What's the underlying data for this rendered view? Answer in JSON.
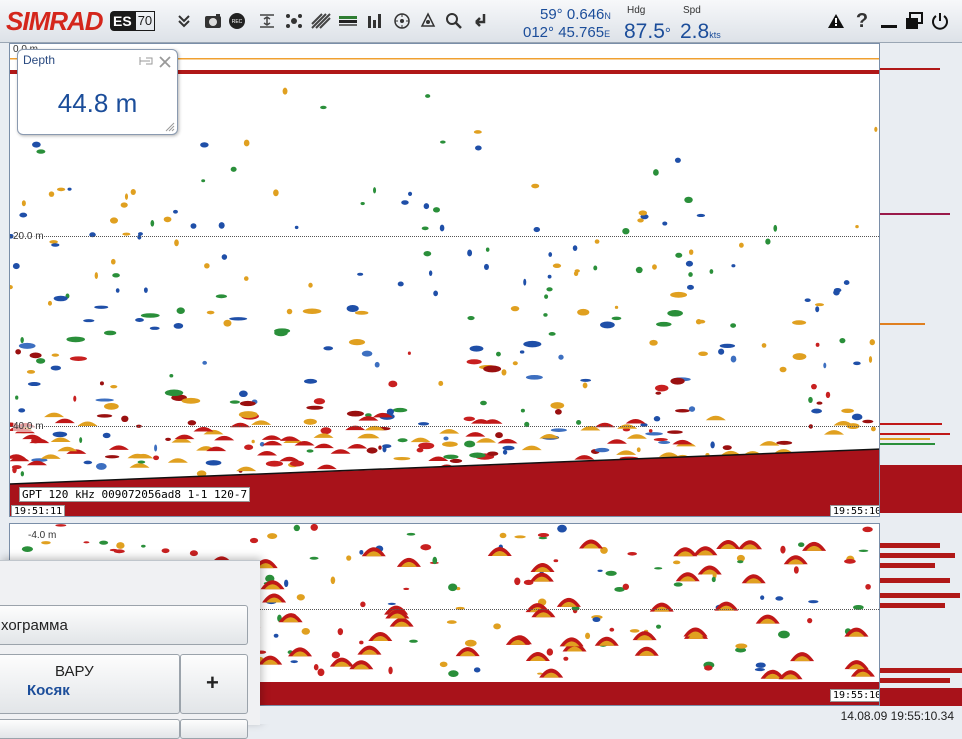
{
  "toolbar": {
    "logo": "SIMRAD",
    "model_es": "ES",
    "model_num": "70",
    "icons": [
      "expand-icon",
      "camera-icon",
      "record-icon",
      "range-icon",
      "pings-icon",
      "echogram-icon",
      "colorbar-icon",
      "bars-icon",
      "target-icon",
      "ship-icon",
      "search-icon",
      "cursor-icon",
      "alarm-icon",
      "help-icon",
      "minimize-icon",
      "restore-icon",
      "power-icon"
    ]
  },
  "navigation": {
    "lat": "59° 0.646",
    "lat_hemi": "N",
    "lon": "012° 45.765",
    "lon_hemi": "E",
    "hdg_label": "Hdg",
    "hdg_value": "87.5",
    "hdg_unit": "°",
    "spd_label": "Spd",
    "spd_value": "2.8",
    "spd_unit": "kts"
  },
  "depth_widget": {
    "title": "Depth",
    "value": "44.8 m"
  },
  "echogram_upper": {
    "depth_labels": [
      "0.0 m",
      "20.0 m",
      "40.0 m"
    ],
    "channel_label": "GPT 120 kHz 009072056ad8 1-1 120-7",
    "time_start": "19:51:11",
    "time_end": "19:55:10"
  },
  "echogram_lower": {
    "depth_label": "-4.0 m",
    "time_end": "19:55:10"
  },
  "menu": {
    "echogram_label": "хограмма",
    "mode_label": "ВАРУ",
    "mode_value": "Косяк",
    "plus_label": "+"
  },
  "status": {
    "datetime": "14.08.09  19:55:10.34"
  },
  "colors": {
    "brand_red": "#d4261c",
    "nav_blue": "#1b4d9a",
    "bottom_red": "#a8121a"
  }
}
